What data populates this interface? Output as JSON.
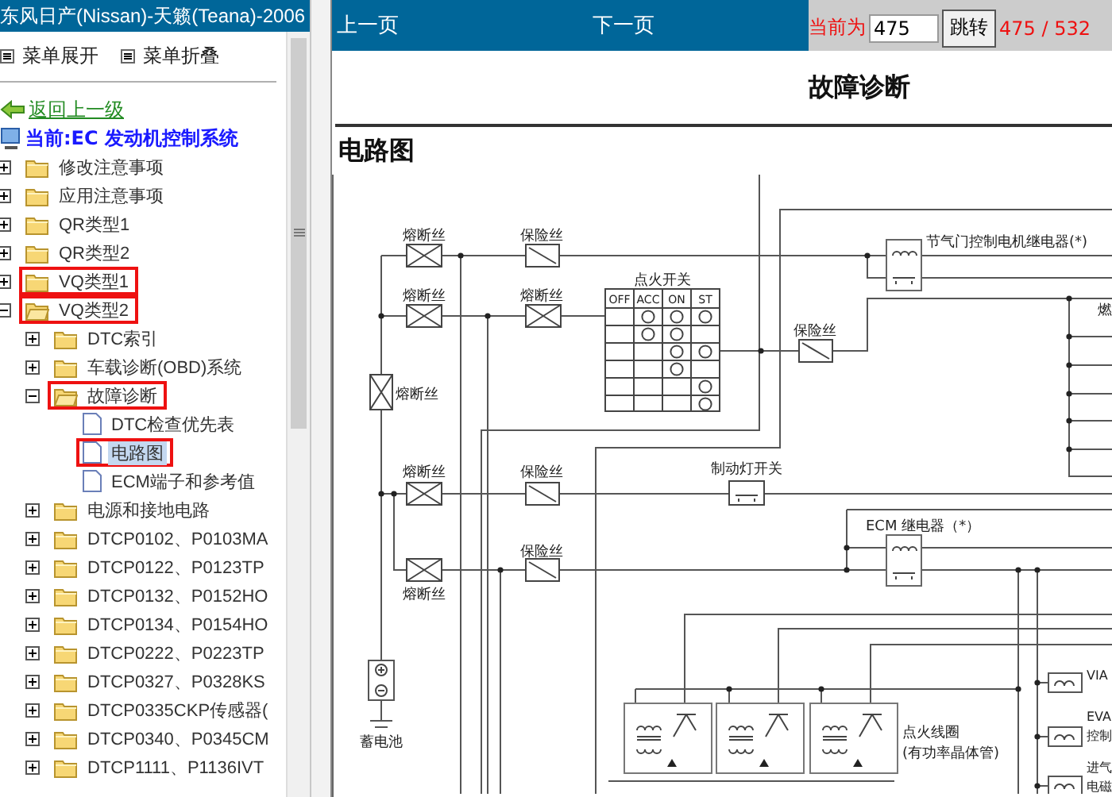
{
  "sidebar": {
    "title": "东风日产(Nissan)-天籁(Teana)-2006",
    "menu_buttons": [
      "菜单展开",
      "菜单折叠"
    ],
    "back_link": "返回上一级",
    "current": "当前:EC 发动机控制系统",
    "tree": [
      {
        "label": "修改注意事项",
        "kind": "folder",
        "expanded": false,
        "selected": false,
        "highlighted": false
      },
      {
        "label": "应用注意事项",
        "kind": "folder",
        "expanded": false,
        "selected": false,
        "highlighted": false
      },
      {
        "label": "QR类型1",
        "kind": "folder",
        "expanded": false,
        "selected": false,
        "highlighted": false
      },
      {
        "label": "QR类型2",
        "kind": "folder",
        "expanded": false,
        "selected": false,
        "highlighted": false
      },
      {
        "label": "VQ类型1",
        "kind": "folder",
        "expanded": false,
        "selected": false,
        "highlighted": true
      },
      {
        "label": "VQ类型2",
        "kind": "folder",
        "expanded": true,
        "selected": false,
        "highlighted": true,
        "children": [
          {
            "label": "DTC索引",
            "kind": "folder",
            "expanded": false,
            "selected": false,
            "highlighted": false
          },
          {
            "label": "车载诊断(OBD)系统",
            "kind": "folder",
            "expanded": false,
            "selected": false,
            "highlighted": false
          },
          {
            "label": "故障诊断",
            "kind": "folder",
            "expanded": true,
            "selected": false,
            "highlighted": true,
            "children": [
              {
                "label": "DTC检查优先表",
                "kind": "page",
                "selected": false,
                "highlighted": false
              },
              {
                "label": "电路图",
                "kind": "page",
                "selected": true,
                "highlighted": true
              },
              {
                "label": "ECM端子和参考值",
                "kind": "page",
                "selected": false,
                "highlighted": false
              }
            ]
          },
          {
            "label": "电源和接地电路",
            "kind": "folder",
            "expanded": false,
            "selected": false,
            "highlighted": false
          },
          {
            "label": "DTCP0102、P0103MA",
            "kind": "folder",
            "expanded": false,
            "selected": false,
            "highlighted": false
          },
          {
            "label": "DTCP0122、P0123TP",
            "kind": "folder",
            "expanded": false,
            "selected": false,
            "highlighted": false
          },
          {
            "label": "DTCP0132、P0152HO",
            "kind": "folder",
            "expanded": false,
            "selected": false,
            "highlighted": false
          },
          {
            "label": "DTCP0134、P0154HO",
            "kind": "folder",
            "expanded": false,
            "selected": false,
            "highlighted": false
          },
          {
            "label": "DTCP0222、P0223TP",
            "kind": "folder",
            "expanded": false,
            "selected": false,
            "highlighted": false
          },
          {
            "label": "DTCP0327、P0328KS",
            "kind": "folder",
            "expanded": false,
            "selected": false,
            "highlighted": false
          },
          {
            "label": "DTCP0335CKP传感器(",
            "kind": "folder",
            "expanded": false,
            "selected": false,
            "highlighted": false
          },
          {
            "label": "DTCP0340、P0345CM",
            "kind": "folder",
            "expanded": false,
            "selected": false,
            "highlighted": false
          },
          {
            "label": "DTCP1111、P1136IVT",
            "kind": "folder",
            "expanded": false,
            "selected": false,
            "highlighted": false
          }
        ]
      }
    ]
  },
  "toolbar": {
    "prev": "上一页",
    "next": "下一页",
    "current_label": "当前为",
    "page_input": "475",
    "go_button": "跳转",
    "page_count": "475 / 532"
  },
  "document": {
    "title": "故障诊断",
    "section": "电路图",
    "diagram": {
      "switch_columns": [
        "OFF",
        "ACC",
        "ON",
        "ST"
      ],
      "labels": [
        "熔断丝",
        "保险丝",
        "熔断丝",
        "熔断丝",
        "点火开关",
        "熔断丝",
        "保险丝",
        "节气门控制电机继电器(*)",
        "燃",
        "熔断丝",
        "保险丝",
        "制动灯开关",
        "ECM 继电器（*）",
        "保险丝",
        "熔断丝",
        "蓄电池",
        "点火线圈",
        "(有功率晶体管)",
        "VIA",
        "EVA",
        "控制",
        "进气",
        "电磁"
      ]
    }
  }
}
